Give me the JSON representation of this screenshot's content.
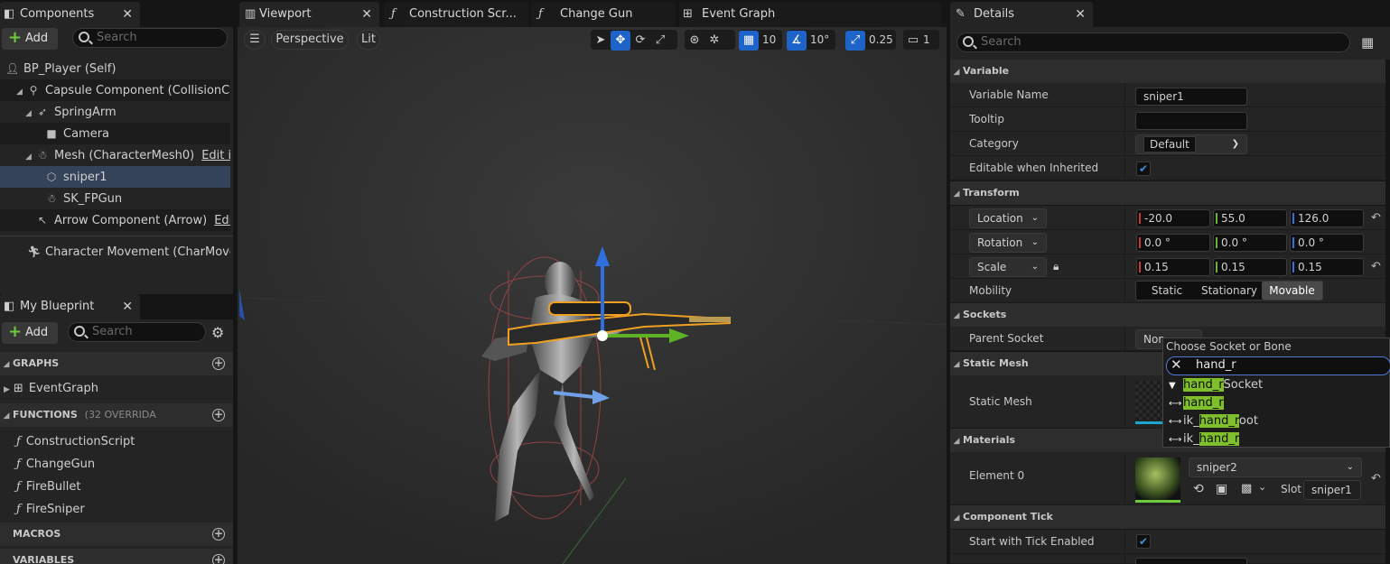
{
  "tabs": {
    "components": "Components",
    "viewport": "Viewport",
    "construction": "Construction Scr...",
    "change_gun": "Change Gun",
    "event_graph": "Event Graph",
    "details": "Details",
    "my_blueprint": "My Blueprint"
  },
  "components": {
    "add_label": "Add",
    "search_placeholder": "Search",
    "tree": [
      {
        "label": "BP_Player (Self)",
        "icon": "person-icon"
      },
      {
        "label": "Capsule Component (CollisionCylinder)",
        "icon": "capsule-icon"
      },
      {
        "label": "SpringArm",
        "icon": "spring-icon"
      },
      {
        "label": "Camera",
        "icon": "camera-icon"
      },
      {
        "label": "Mesh (CharacterMesh0)",
        "icon": "skeleton-icon",
        "link": "Edit in C++"
      },
      {
        "label": "sniper1",
        "icon": "cube-icon"
      },
      {
        "label": "SK_FPGun",
        "icon": "skeleton-icon"
      },
      {
        "label": "Arrow Component (Arrow)",
        "icon": "arrow-icon",
        "link": "Edit in C++"
      },
      {
        "label": "Character Movement (CharMoveComp)",
        "icon": "movement-icon"
      }
    ]
  },
  "blueprint": {
    "add_label": "Add",
    "search_placeholder": "Search",
    "graphs_label": "GRAPHS",
    "event_graph": "EventGraph",
    "functions_label": "FUNCTIONS",
    "functions_count": "(32 OVERRIDA",
    "functions": [
      "ConstructionScript",
      "ChangeGun",
      "FireBullet",
      "FireSniper"
    ],
    "macros_label": "MACROS",
    "variables_label": "VARIABLES"
  },
  "viewport": {
    "perspective": "Perspective",
    "lit": "Lit",
    "grid_snap": "10",
    "rot_snap": "10°",
    "scale_snap": "0.25",
    "cam_speed": "1"
  },
  "details": {
    "search_placeholder": "Search",
    "sections": {
      "variable": "Variable",
      "transform": "Transform",
      "sockets": "Sockets",
      "static_mesh": "Static Mesh",
      "materials": "Materials",
      "component_tick": "Component Tick"
    },
    "variable_name_label": "Variable Name",
    "variable_name": "sniper1",
    "tooltip_label": "Tooltip",
    "category_label": "Category",
    "category": "Default",
    "editable_label": "Editable when Inherited",
    "location_label": "Location",
    "location": [
      "-20.0",
      "55.0",
      "126.0"
    ],
    "rotation_label": "Rotation",
    "rotation": [
      "0.0 °",
      "0.0 °",
      "0.0 °"
    ],
    "scale_label": "Scale",
    "scale": [
      "0.15",
      "0.15",
      "0.15"
    ],
    "mobility_label": "Mobility",
    "mobility_options": [
      "Static",
      "Stationary",
      "Movable"
    ],
    "parent_socket_label": "Parent Socket",
    "parent_socket_value": "Non",
    "static_mesh_label": "Static Mesh",
    "element0_label": "Element 0",
    "material": "sniper2",
    "slot_label": "Slot",
    "slot_value": "sniper1",
    "start_tick_label": "Start with Tick Enabled"
  },
  "socket_popup": {
    "title": "Choose Socket or Bone",
    "query": "hand_r",
    "options": [
      {
        "pre": "",
        "hl": "hand_r",
        "post": "Socket",
        "icon": "socket-icon"
      },
      {
        "pre": "",
        "hl": "hand_r",
        "post": "",
        "icon": "bone-icon"
      },
      {
        "pre": "ik_",
        "hl": "hand_r",
        "post": "oot",
        "icon": "bone-icon"
      },
      {
        "pre": "ik_",
        "hl": "hand_r",
        "post": "",
        "icon": "bone-icon"
      }
    ]
  }
}
